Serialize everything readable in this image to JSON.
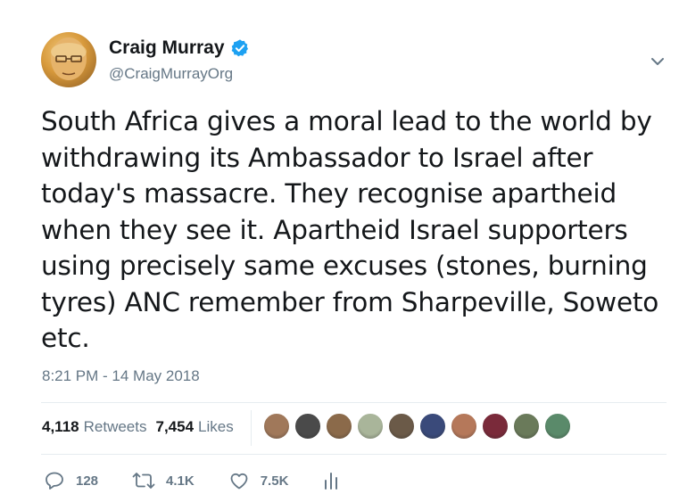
{
  "author": {
    "name": "Craig Murray",
    "handle": "@CraigMurrayOrg",
    "verified": true
  },
  "tweet": {
    "text": "South Africa gives a moral lead to the world by withdrawing its Ambassador to Israel after today's massacre. They recognise apartheid when they see it. Apartheid Israel supporters using precisely same excuses (stones, burning tyres) ANC remember from Sharpeville, Soweto etc.",
    "timestamp": "8:21 PM - 14 May 2018"
  },
  "stats": {
    "retweets_count": "4,118",
    "retweets_label": "Retweets",
    "likes_count": "7,454",
    "likes_label": "Likes"
  },
  "likers": [
    {
      "color": "#a0785a"
    },
    {
      "color": "#4a4a4a"
    },
    {
      "color": "#8b6a4a"
    },
    {
      "color": "#a9b59a"
    },
    {
      "color": "#6b5a48"
    },
    {
      "color": "#3a4a7a"
    },
    {
      "color": "#b5785a"
    },
    {
      "color": "#7a2a3a"
    },
    {
      "color": "#6a7a5a"
    },
    {
      "color": "#5a8a6a"
    }
  ],
  "actions": {
    "replies": "128",
    "retweets": "4.1K",
    "likes": "7.5K"
  },
  "icons": {
    "verified": "verified-badge-icon",
    "caret": "chevron-down-icon",
    "reply": "reply-icon",
    "retweet": "retweet-icon",
    "like": "heart-icon",
    "analytics": "analytics-icon"
  },
  "colors": {
    "verified": "#1da1f2",
    "secondary_text": "#657786",
    "primary_text": "#14171a",
    "divider": "#e6ecf0"
  }
}
